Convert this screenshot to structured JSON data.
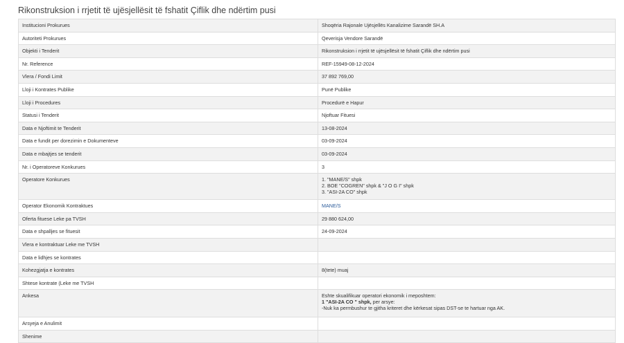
{
  "page": {
    "title": "Rikonstruksion i rrjetit të ujësjellësit të fshatit Çiflik dhe ndërtim pusi"
  },
  "colors": {
    "row_odd": "#f2f2f2",
    "row_even": "#ffffff",
    "border": "#dddddd",
    "link": "#2b5b9a"
  },
  "details": {
    "institution": {
      "label": "Institucioni Prokurues",
      "value": "Shoqëria Rajonale Ujësjellës Kanalizime Sarandë SH.A"
    },
    "authority": {
      "label": "Autoriteti Prokurues",
      "value": "Qeverisja Vendore Sarandë"
    },
    "object": {
      "label": "Objekti i Tenderit",
      "value": "Rikonstruksion i rrjetit të ujësjellësit të fshatit Çiflik dhe ndërtim pusi"
    },
    "reference": {
      "label": "Nr. Reference",
      "value": "REF-15949-08-12-2024"
    },
    "limit_fund": {
      "label": "Vlera / Fondi Limit",
      "value": "37 892 769,00"
    },
    "contract_type": {
      "label": "Lloji i Kontrates Publike",
      "value": "Punë Publike"
    },
    "procedure_type": {
      "label": "Lloji i Procedures",
      "value": "Procedurë e Hapur"
    },
    "status": {
      "label": "Statusi i Tenderit",
      "value": "Njoftuar Fituesi"
    },
    "notice_date": {
      "label": "Data e Njoftimit te Tenderit",
      "value": "13-08-2024"
    },
    "submission_deadline": {
      "label": "Data e fundit per dorezimin e Dokumenteve",
      "value": "03-09-2024"
    },
    "opening_date": {
      "label": "Data e mbajtjes se tenderit",
      "value": "03-09-2024"
    },
    "operators_count": {
      "label": "Nr. i Operatoreve Konkurues",
      "value": "3"
    },
    "operators": {
      "label": "Operatore Konkurues",
      "lines": [
        "1. \"MANE/S\" shpk",
        "2. BOE \"COGREN\" shpk & \"J O G I\" shpk",
        "3. \"ASI-2A CO\" shpk"
      ]
    },
    "contracting_operator": {
      "label": "Operator Ekonomik Kontraktues",
      "value": "MANE/S"
    },
    "winning_offer": {
      "label": "Oferta fituese Leke pa TVSH",
      "value": "29 880 624,00"
    },
    "winner_date": {
      "label": "Data e shpalljes se fituesit",
      "value": "24-09-2024"
    },
    "contracted_value": {
      "label": "Vlera e kontraktuar Leke me TVSH",
      "value": ""
    },
    "contract_date": {
      "label": "Data e lidhjes se kontrates",
      "value": ""
    },
    "duration": {
      "label": "Kohezgjatja e kontrates",
      "value": "8(tete) muaj"
    },
    "extension": {
      "label": "Shtese kontrate (Leke me TVSH",
      "value": ""
    },
    "annex": {
      "label": "Ankesa",
      "line1": "Eshte skualifikuar operatori ekonomik i meposhtem:",
      "line2": "1 \"ASI-2A CO \" shpk,",
      "line2_suffix": " per arsye:",
      "line3": "-Nuk ka permbushur te gjitha kriteret dhe kërkesat sipas DST-se te hartuar nga AK."
    },
    "cancel_reason": {
      "label": "Arsyeja e Anulimit",
      "value": ""
    },
    "notes": {
      "label": "Shenime",
      "value": ""
    }
  }
}
